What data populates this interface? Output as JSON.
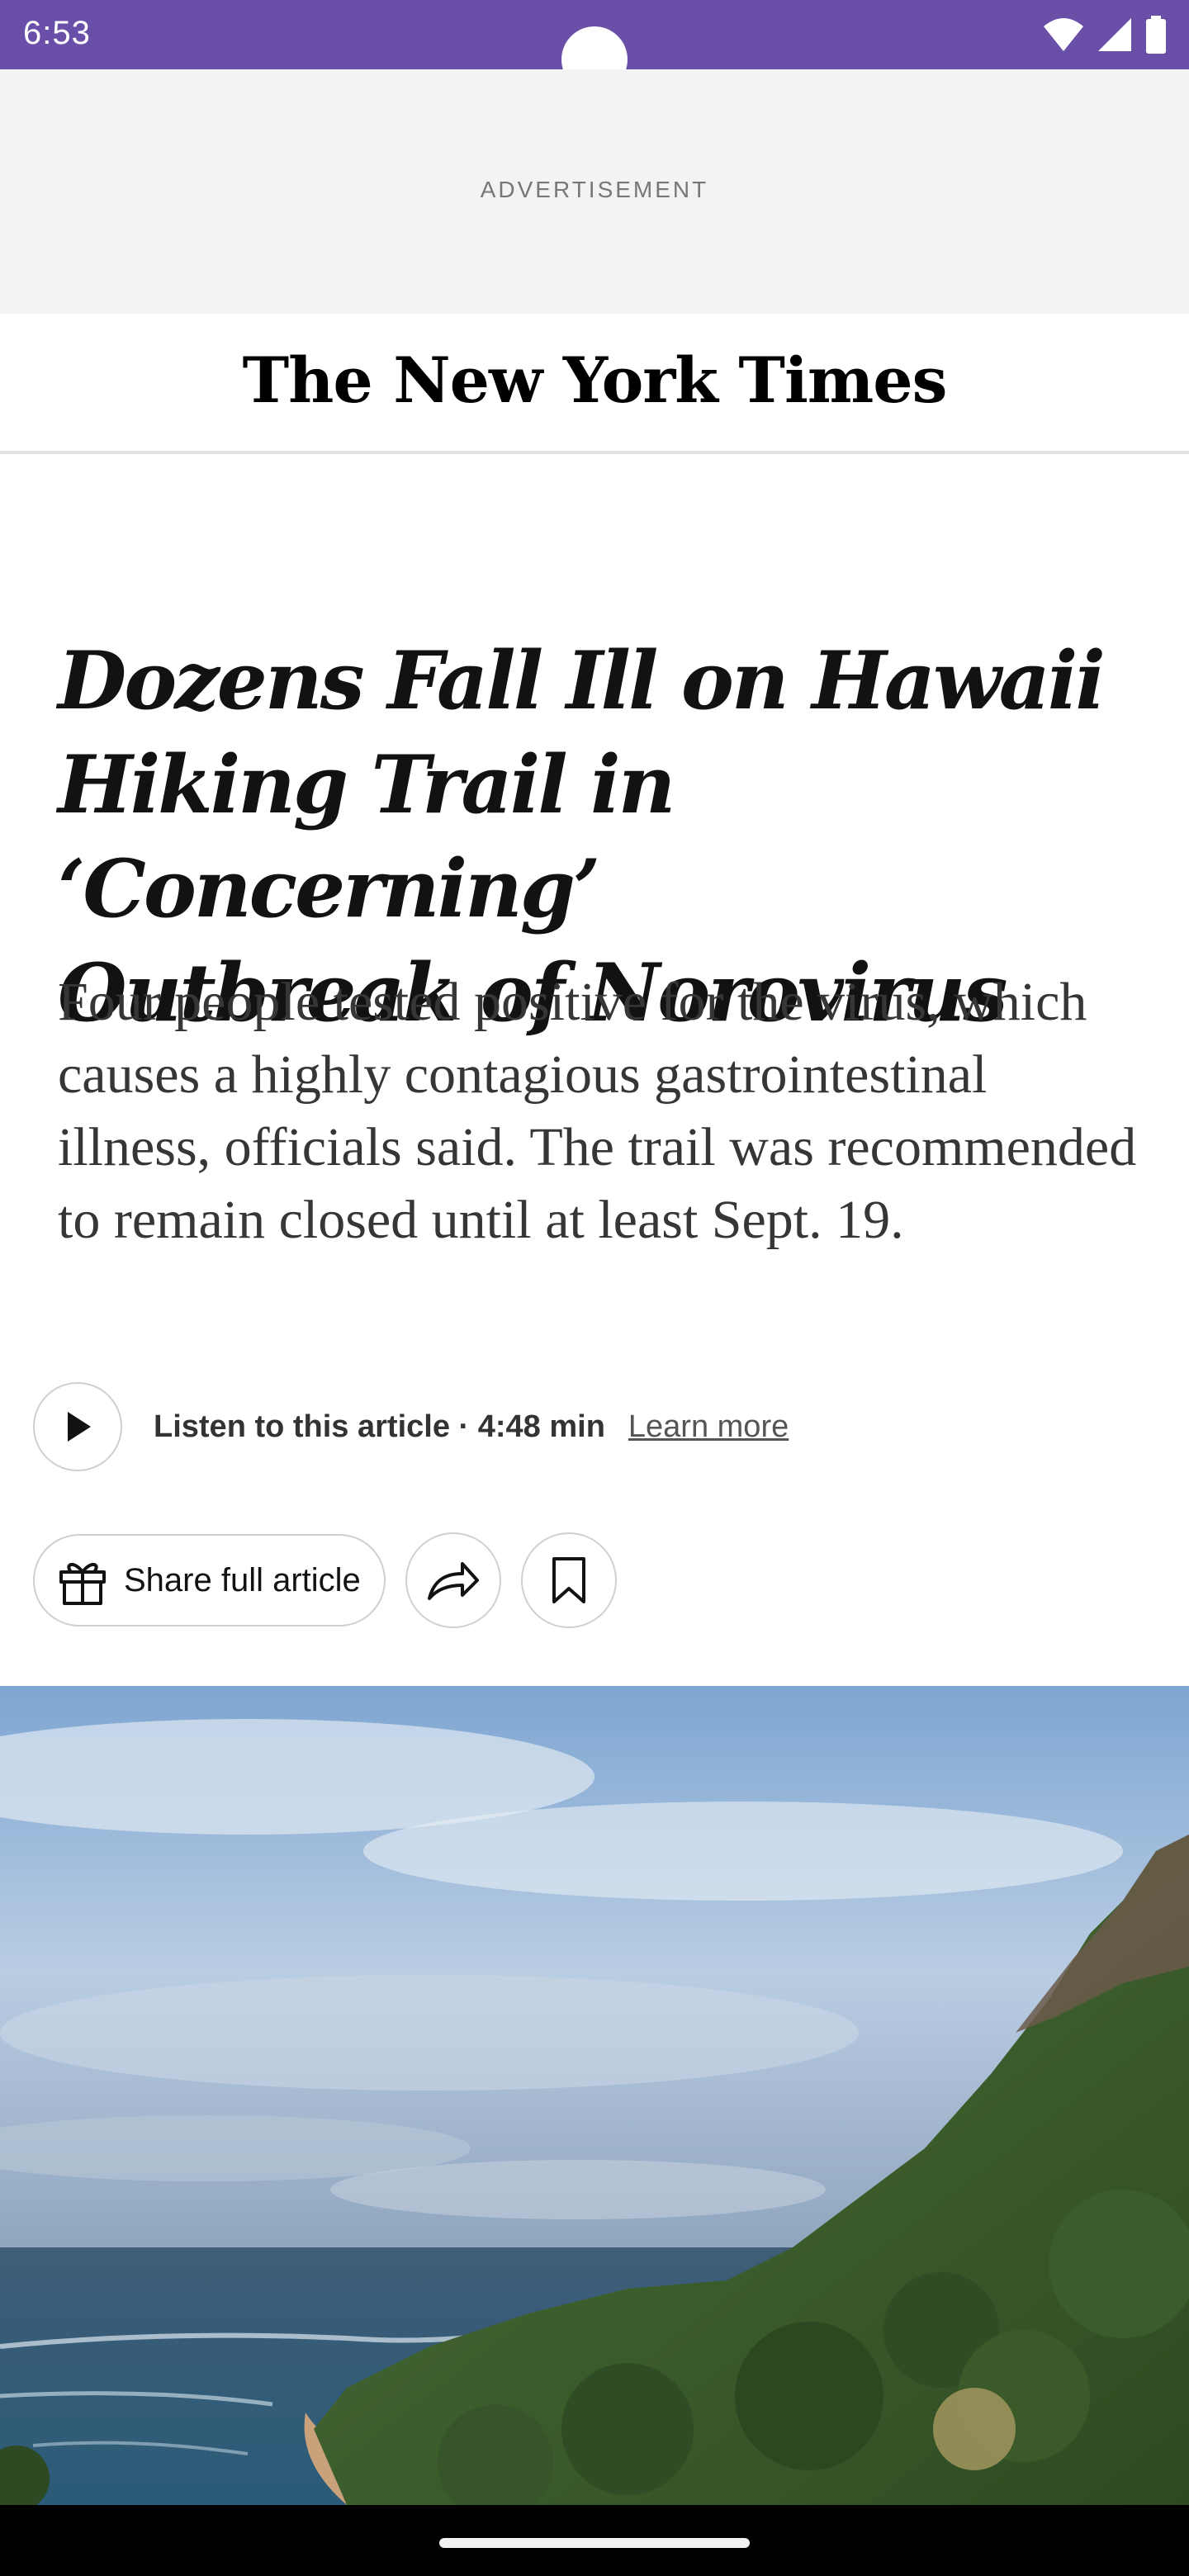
{
  "status_bar": {
    "time": "6:53",
    "icons": [
      "wifi-icon",
      "cellular-signal-icon",
      "battery-icon"
    ],
    "background_color": "#6a4fa8"
  },
  "advertisement": {
    "label": "ADVERTISEMENT"
  },
  "masthead": {
    "logo_text": "The New York Times"
  },
  "article": {
    "headline_lines": [
      "Dozens Fall Ill on Hawaii",
      "Hiking Trail in ‘Concerning’",
      "Outbreak of Norovirus"
    ],
    "summary": "Four people tested positive for the virus, which causes a highly contagious gastrointestinal illness, officials said. The trail was recommended to remain closed until at least Sept. 19."
  },
  "audio": {
    "listen_label": "Listen to this article · 4:48 min",
    "learn_more_label": "Learn more",
    "play_icon": "play-icon"
  },
  "actions": {
    "share_full_article_label": "Share full article",
    "gift_icon": "gift-icon",
    "share_icon": "share-arrow-icon",
    "bookmark_icon": "bookmark-icon"
  }
}
